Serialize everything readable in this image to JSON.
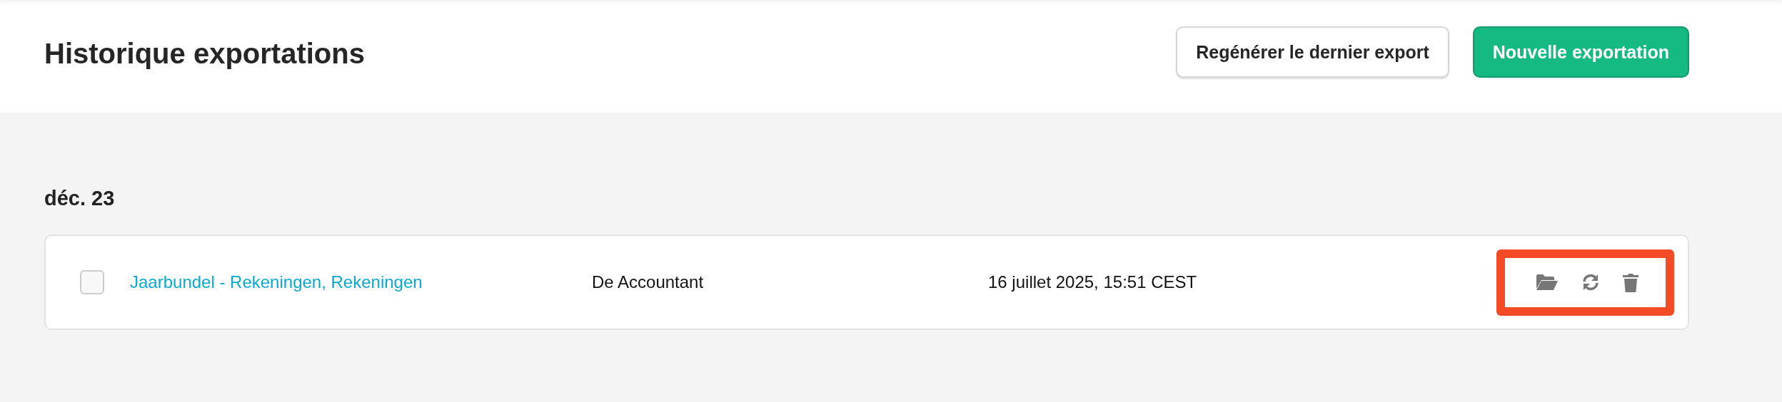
{
  "header": {
    "title": "Historique exportations",
    "buttons": [
      {
        "label": "Regénérer le dernier export",
        "kind": "secondary"
      },
      {
        "label": "Nouvelle exportation",
        "kind": "primary"
      }
    ]
  },
  "groups": [
    {
      "heading": "déc. 23",
      "rows": [
        {
          "checked": false,
          "name": "Jaarbundel - Rekeningen, Rekeningen",
          "author": "De Accountant",
          "date": "16 juillet 2025, 15:51 CEST",
          "highlighted": true,
          "actions": [
            {
              "kind": "folder"
            },
            {
              "kind": "refresh"
            },
            {
              "kind": "trash"
            }
          ]
        }
      ]
    }
  ]
}
